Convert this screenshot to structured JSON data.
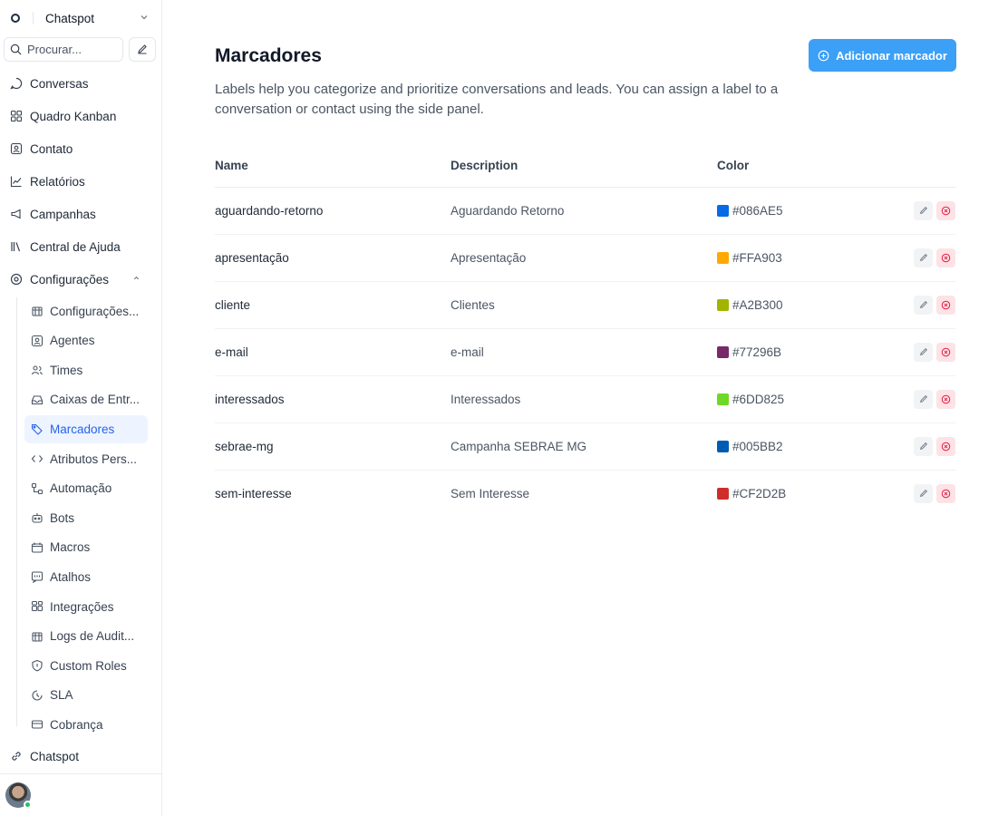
{
  "workspace": {
    "name": "Chatspot"
  },
  "search": {
    "placeholder": "Procurar..."
  },
  "nav": {
    "conversas": "Conversas",
    "kanban": "Quadro Kanban",
    "contato": "Contato",
    "relatorios": "Relatórios",
    "campanhas": "Campanhas",
    "ajuda": "Central de Ajuda",
    "configuracoes": "Configurações"
  },
  "settings_items": [
    {
      "label": "Configurações...",
      "icon": "building-icon"
    },
    {
      "label": "Agentes",
      "icon": "agent-icon"
    },
    {
      "label": "Times",
      "icon": "team-icon"
    },
    {
      "label": "Caixas de Entr...",
      "icon": "inbox-icon"
    },
    {
      "label": "Marcadores",
      "icon": "tag-icon"
    },
    {
      "label": "Atributos Pers...",
      "icon": "code-icon"
    },
    {
      "label": "Automação",
      "icon": "automation-icon"
    },
    {
      "label": "Bots",
      "icon": "bot-icon"
    },
    {
      "label": "Macros",
      "icon": "macro-icon"
    },
    {
      "label": "Atalhos",
      "icon": "shortcut-icon"
    },
    {
      "label": "Integrações",
      "icon": "integrations-icon"
    },
    {
      "label": "Logs de Audit...",
      "icon": "audit-icon"
    },
    {
      "label": "Custom Roles",
      "icon": "shield-icon"
    },
    {
      "label": "SLA",
      "icon": "sla-icon"
    },
    {
      "label": "Cobrança",
      "icon": "billing-icon"
    }
  ],
  "footer": {
    "link": "Chatspot"
  },
  "page": {
    "title": "Marcadores",
    "add_button": "Adicionar marcador",
    "description": "Labels help you categorize and prioritize conversations and leads. You can assign a label to a conversation or contact using the side panel."
  },
  "table": {
    "headers": {
      "name": "Name",
      "description": "Description",
      "color": "Color"
    },
    "rows": [
      {
        "name": "aguardando-retorno",
        "description": "Aguardando Retorno",
        "color": "#086AE5"
      },
      {
        "name": "apresentação",
        "description": "Apresentação",
        "color": "#FFA903"
      },
      {
        "name": "cliente",
        "description": "Clientes",
        "color": "#A2B300"
      },
      {
        "name": "e-mail",
        "description": "e-mail",
        "color": "#77296B"
      },
      {
        "name": "interessados",
        "description": "Interessados",
        "color": "#6DD825"
      },
      {
        "name": "sebrae-mg",
        "description": "Campanha SEBRAE MG",
        "color": "#005BB2"
      },
      {
        "name": "sem-interesse",
        "description": "Sem Interesse",
        "color": "#CF2D2B"
      }
    ]
  },
  "colors": {
    "accent": "#3BA0F6",
    "active_bg": "#EEF4FF",
    "active_text": "#2563EB",
    "delete_bg": "#FDE2E6",
    "delete_icon": "#E11D48"
  }
}
